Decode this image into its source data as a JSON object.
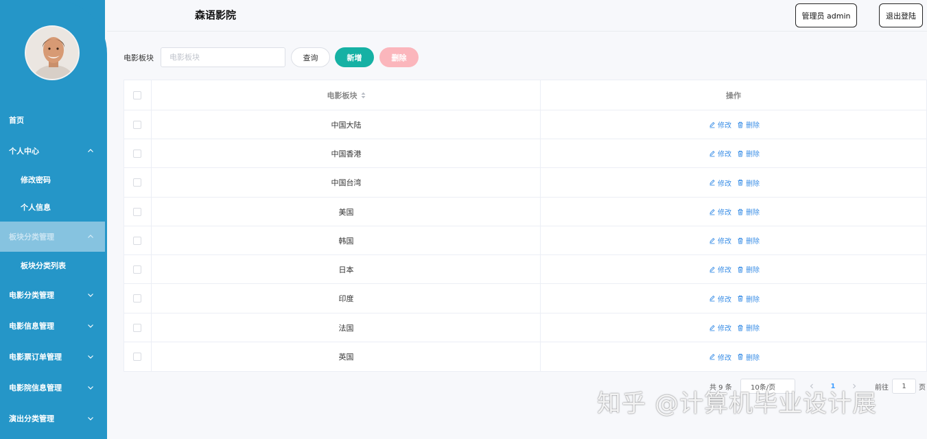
{
  "app": {
    "title": "森语影院"
  },
  "header": {
    "admin_label": "管理员 admin",
    "logout_label": "退出登陆"
  },
  "colors": {
    "sidebar": "#2596c8",
    "active_item": "#86c3e0",
    "add": "#16b1a4",
    "delete": "#fbb6bc",
    "link": "#3a8ee6"
  },
  "sidebar": {
    "avatar": "user-avatar-photo",
    "items": [
      {
        "label": "首页",
        "type": "item",
        "chevron": "none"
      },
      {
        "label": "个人中心",
        "type": "group",
        "chevron": "up"
      },
      {
        "label": "修改密码",
        "type": "sub"
      },
      {
        "label": "个人信息",
        "type": "sub"
      },
      {
        "label": "板块分类管理",
        "type": "group",
        "chevron": "up",
        "active": true
      },
      {
        "label": "板块分类列表",
        "type": "sub"
      },
      {
        "label": "电影分类管理",
        "type": "group",
        "chevron": "down"
      },
      {
        "label": "电影信息管理",
        "type": "group",
        "chevron": "down"
      },
      {
        "label": "电影票订单管理",
        "type": "group",
        "chevron": "down"
      },
      {
        "label": "电影院信息管理",
        "type": "group",
        "chevron": "down"
      },
      {
        "label": "演出分类管理",
        "type": "group",
        "chevron": "down"
      }
    ]
  },
  "search": {
    "label": "电影板块",
    "placeholder": "电影板块",
    "value": "",
    "query_label": "查询",
    "add_label": "新增",
    "delete_label": "删除"
  },
  "table": {
    "columns": {
      "name": "电影板块",
      "ops": "操作"
    },
    "edit_label": "修改",
    "delete_label": "删除",
    "rows": [
      "中国大陆",
      "中国香港",
      "中国台湾",
      "美国",
      "韩国",
      "日本",
      "印度",
      "法国",
      "英国"
    ]
  },
  "pagination": {
    "total_text": "共 9 条",
    "page_size": "10条/页",
    "current_page": "1",
    "goto_label": "前往",
    "goto_value": "1",
    "page_unit": "页"
  },
  "watermark": "知乎 @计算机毕业设计展"
}
